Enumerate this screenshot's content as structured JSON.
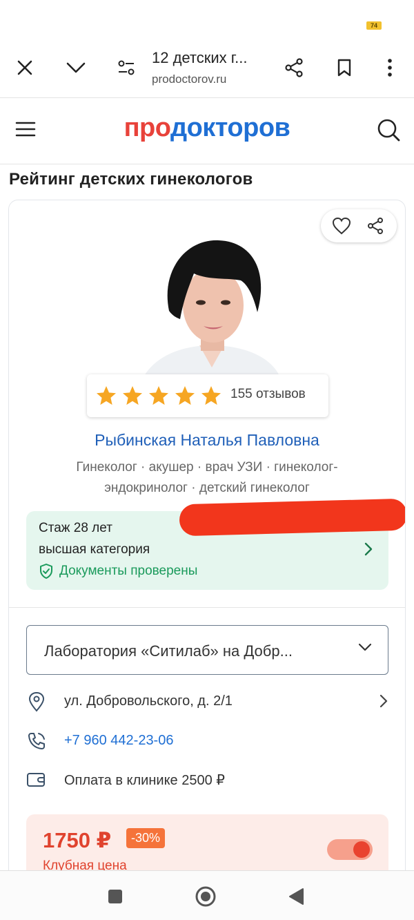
{
  "status": {
    "battery": "74"
  },
  "browser": {
    "title": "12 детских г...",
    "url": "prodoctorov.ru"
  },
  "site": {
    "logo_part1": "про",
    "logo_part2": "докторов"
  },
  "page": {
    "title": "Рейтинг детских гинекологов"
  },
  "doctor": {
    "rating_stars": 5,
    "reviews": "155 отзывов",
    "name": "Рыбинская Наталья Павловна",
    "specialty": "Гинеколог · акушер · врач УЗИ · гинеколог-эндокринолог · детский гинеколог",
    "experience": "Стаж 28 лет",
    "category": "высшая категория",
    "documents": "Документы проверены"
  },
  "clinic": {
    "selected": "Лаборатория «Ситилаб» на Добр...",
    "address": "ул. Добровольского, д. 2/1",
    "phone": "+7 960 442-23-06",
    "payment": "Оплата в клинике 2500 ₽"
  },
  "price": {
    "value": "1750 ₽",
    "discount": "-30%",
    "label": "Клубная цена",
    "toggle_on": true
  },
  "colors": {
    "brand_red": "#e8423a",
    "brand_blue": "#1f6fd4",
    "star": "#f6a623",
    "green": "#1a9a5b"
  }
}
